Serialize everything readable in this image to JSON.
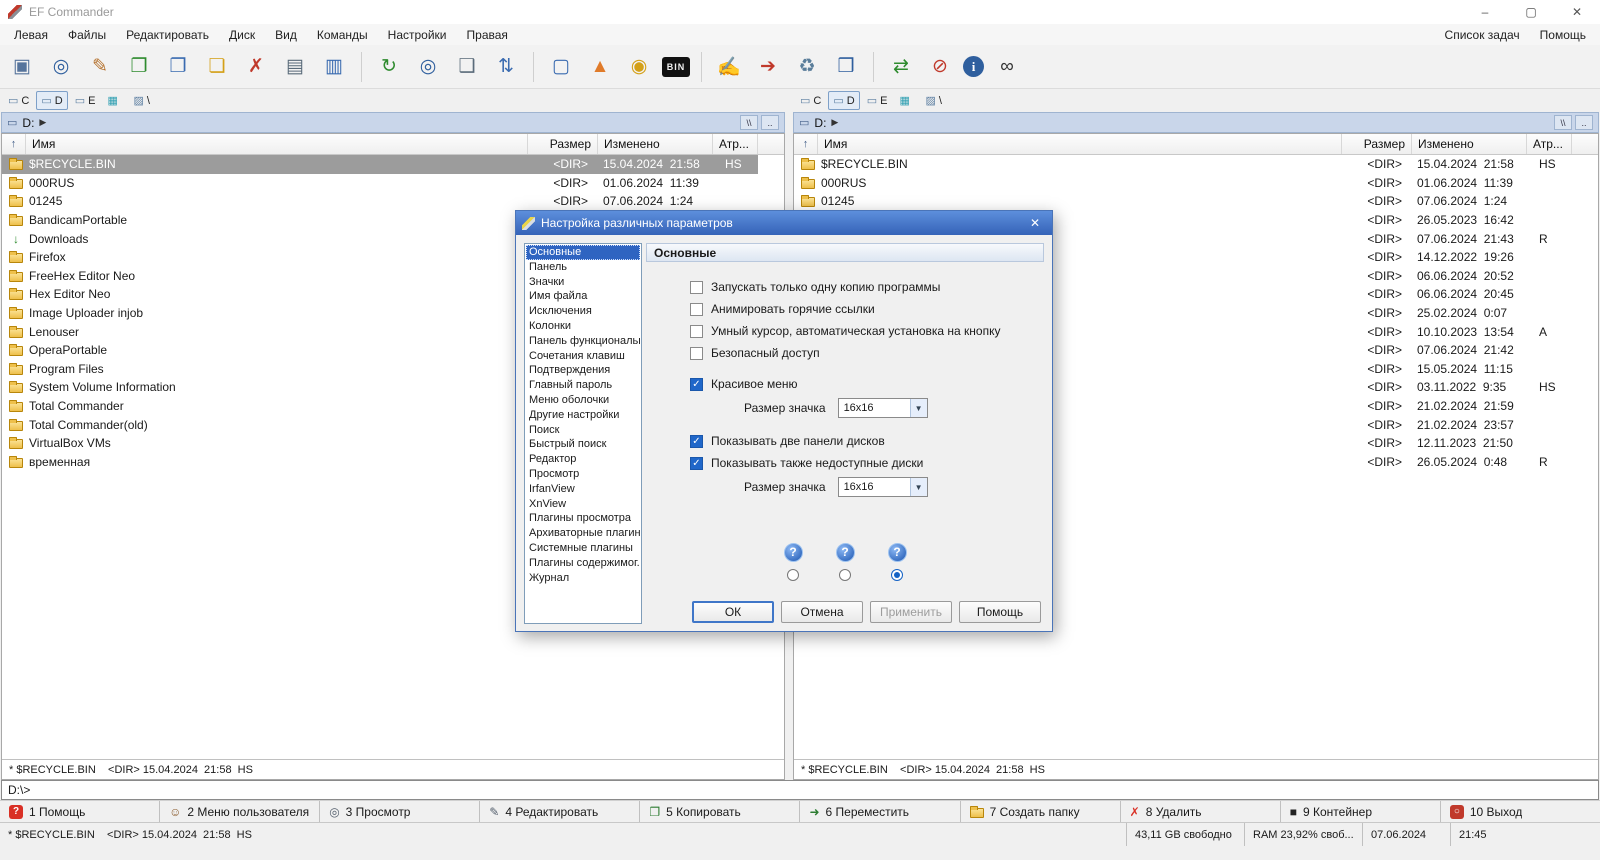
{
  "window": {
    "title": "EF Commander"
  },
  "window_controls": {
    "minimize": "–",
    "maximize": "▢",
    "close": "✕"
  },
  "menubar": {
    "items": [
      "Левая",
      "Файлы",
      "Редактировать",
      "Диск",
      "Вид",
      "Команды",
      "Настройки",
      "Правая"
    ],
    "right_items": [
      "Список задач",
      "Помощь"
    ]
  },
  "toolbar": {
    "groups": [
      [
        {
          "name": "console-window-icon",
          "glyph": "▣",
          "color": "#56749c"
        },
        {
          "name": "search-icon",
          "glyph": "◎",
          "color": "#2f5f9e"
        },
        {
          "name": "edit-file-icon",
          "glyph": "✎",
          "color": "#b5722e"
        },
        {
          "name": "copy-files-icon",
          "glyph": "❐",
          "color": "#2e8b2e"
        },
        {
          "name": "compare-files-icon",
          "glyph": "❐",
          "color": "#3a6bb0"
        },
        {
          "name": "move-folder-icon",
          "glyph": "❏",
          "color": "#d4a017"
        },
        {
          "name": "delete-file-icon",
          "glyph": "✗",
          "color": "#c0392b"
        },
        {
          "name": "print-icon",
          "glyph": "▤",
          "color": "#5a6b7a"
        },
        {
          "name": "properties-icon",
          "glyph": "▥",
          "color": "#3a6bb0"
        }
      ],
      [
        {
          "name": "refresh-icon",
          "glyph": "↻",
          "color": "#2e8b2e"
        },
        {
          "name": "find-files-icon",
          "glyph": "◎",
          "color": "#2f5f9e"
        },
        {
          "name": "split-view-icon",
          "glyph": "❑",
          "color": "#5a6b7a"
        },
        {
          "name": "sync-dirs-icon",
          "glyph": "⇅",
          "color": "#3a6bb0"
        }
      ],
      [
        {
          "name": "quick-view-icon",
          "glyph": "▢",
          "color": "#3a6bb0"
        },
        {
          "name": "cone-icon",
          "glyph": "▲",
          "color": "#e07b2a"
        },
        {
          "name": "search-new-icon",
          "glyph": "◉",
          "color": "#d4a017"
        },
        {
          "name": "hex-view-icon",
          "glyph": "BIN",
          "color": "#f0f0f0",
          "bg": "#111111"
        }
      ],
      [
        {
          "name": "checklist-edit-icon",
          "glyph": "✍",
          "color": "#3a6bb0"
        },
        {
          "name": "screen-export-icon",
          "glyph": "➔",
          "color": "#c0392b"
        },
        {
          "name": "recycle-bin-icon",
          "glyph": "♻",
          "color": "#5a7d9a"
        },
        {
          "name": "remote-screen-icon",
          "glyph": "❒",
          "color": "#2f5f9e"
        }
      ],
      [
        {
          "name": "swap-panels-icon",
          "glyph": "⇄",
          "color": "#2e8b2e"
        },
        {
          "name": "disconnect-icon",
          "glyph": "⊘",
          "color": "#c0392b"
        },
        {
          "name": "info-icon",
          "glyph": "i",
          "color": "#ffffff",
          "bg": "#2f5f9e",
          "round": true
        },
        {
          "name": "find-duplicates-icon",
          "glyph": "∞",
          "color": "#333333"
        }
      ]
    ]
  },
  "panels": {
    "left": {
      "drives": [
        {
          "glyph": "▭",
          "label": "C"
        },
        {
          "glyph": "▭",
          "label": "D",
          "pressed": true
        },
        {
          "glyph": "▭",
          "label": "E"
        },
        {
          "glyph": "▦",
          "label": "",
          "color": "#2a9db0"
        },
        {
          "glyph": "▨",
          "label": "\\",
          "color": "#5a7da0"
        }
      ],
      "path": "D:",
      "path_glyph": "▭",
      "path_arrow": "▶",
      "path_buttons": [
        "\\\\",
        ".."
      ],
      "columns": [
        "Имя",
        "Размер",
        "Изменено",
        "Атр..."
      ],
      "rows": [
        {
          "icon": "folder",
          "name": "$RECYCLE.BIN",
          "size": "<DIR>",
          "date": "15.04.2024  21:58",
          "attr": "HS",
          "selected": true
        },
        {
          "icon": "folder",
          "name": "000RUS",
          "size": "<DIR>",
          "date": "01.06.2024  11:39",
          "attr": ""
        },
        {
          "icon": "folder",
          "name": "01245",
          "size": "<DIR>",
          "date": "07.06.2024  1:24",
          "attr": ""
        },
        {
          "icon": "folder",
          "name": "BandicamPortable",
          "size": "",
          "date": "",
          "attr": ""
        },
        {
          "icon": "downloads",
          "name": "Downloads",
          "size": "",
          "date": "",
          "attr": ""
        },
        {
          "icon": "folder",
          "name": "Firefox",
          "size": "",
          "date": "",
          "attr": ""
        },
        {
          "icon": "folder",
          "name": "FreeHex Editor Neo",
          "size": "",
          "date": "",
          "attr": ""
        },
        {
          "icon": "folder",
          "name": "Hex Editor Neo",
          "size": "",
          "date": "",
          "attr": ""
        },
        {
          "icon": "folder",
          "name": "Image Uploader injob",
          "size": "",
          "date": "",
          "attr": ""
        },
        {
          "icon": "folder",
          "name": "Lenouser",
          "size": "",
          "date": "",
          "attr": ""
        },
        {
          "icon": "folder",
          "name": "OperaPortable",
          "size": "",
          "date": "",
          "attr": ""
        },
        {
          "icon": "folder",
          "name": "Program Files",
          "size": "",
          "date": "",
          "attr": ""
        },
        {
          "icon": "folder",
          "name": "System Volume Information",
          "size": "",
          "date": "",
          "attr": ""
        },
        {
          "icon": "folder",
          "name": "Total Commander",
          "size": "",
          "date": "",
          "attr": ""
        },
        {
          "icon": "folder",
          "name": "Total Commander(old)",
          "size": "",
          "date": "",
          "attr": ""
        },
        {
          "icon": "folder",
          "name": "VirtualBox VMs",
          "size": "",
          "date": "",
          "attr": ""
        },
        {
          "icon": "folder",
          "name": "временная",
          "size": "",
          "date": "",
          "attr": ""
        }
      ],
      "status": "* $RECYCLE.BIN    <DIR> 15.04.2024  21:58  HS"
    },
    "right": {
      "drives": [
        {
          "glyph": "▭",
          "label": "C"
        },
        {
          "glyph": "▭",
          "label": "D",
          "pressed": true
        },
        {
          "glyph": "▭",
          "label": "E"
        },
        {
          "glyph": "▦",
          "label": "",
          "color": "#2a9db0"
        },
        {
          "glyph": "▨",
          "label": "\\",
          "color": "#5a7da0"
        }
      ],
      "path": "D:",
      "path_glyph": "▭",
      "path_arrow": "▶",
      "path_buttons": [
        "\\\\",
        ".."
      ],
      "columns": [
        "Имя",
        "Размер",
        "Изменено",
        "Атр..."
      ],
      "rows": [
        {
          "icon": "folder",
          "name": "$RECYCLE.BIN",
          "size": "<DIR>",
          "date": "15.04.2024  21:58",
          "attr": "HS"
        },
        {
          "icon": "folder",
          "name": "000RUS",
          "size": "<DIR>",
          "date": "01.06.2024  11:39",
          "attr": ""
        },
        {
          "icon": "folder",
          "name": "01245",
          "size": "<DIR>",
          "date": "07.06.2024  1:24",
          "attr": ""
        },
        {
          "icon": "none",
          "name": "",
          "size": "<DIR>",
          "date": "26.05.2023  16:42",
          "attr": ""
        },
        {
          "icon": "none",
          "name": "",
          "size": "<DIR>",
          "date": "07.06.2024  21:43",
          "attr": "R"
        },
        {
          "icon": "none",
          "name": "",
          "size": "<DIR>",
          "date": "14.12.2022  19:26",
          "attr": ""
        },
        {
          "icon": "none",
          "name": "",
          "size": "<DIR>",
          "date": "06.06.2024  20:52",
          "attr": ""
        },
        {
          "icon": "none",
          "name": "",
          "size": "<DIR>",
          "date": "06.06.2024  20:45",
          "attr": ""
        },
        {
          "icon": "none",
          "name": "",
          "size": "<DIR>",
          "date": "25.02.2024  0:07",
          "attr": ""
        },
        {
          "icon": "none",
          "name": "",
          "size": "<DIR>",
          "date": "10.10.2023  13:54",
          "attr": "A"
        },
        {
          "icon": "none",
          "name": "",
          "size": "<DIR>",
          "date": "07.06.2024  21:42",
          "attr": ""
        },
        {
          "icon": "none",
          "name": "",
          "size": "<DIR>",
          "date": "15.05.2024  11:15",
          "attr": ""
        },
        {
          "icon": "none",
          "name": "",
          "size": "<DIR>",
          "date": "03.11.2022  9:35",
          "attr": "HS"
        },
        {
          "icon": "none",
          "name": "",
          "size": "<DIR>",
          "date": "21.02.2024  21:59",
          "attr": ""
        },
        {
          "icon": "none",
          "name": "",
          "size": "<DIR>",
          "date": "21.02.2024  23:57",
          "attr": ""
        },
        {
          "icon": "none",
          "name": "",
          "size": "<DIR>",
          "date": "12.11.2023  21:50",
          "attr": ""
        },
        {
          "icon": "none",
          "name": "",
          "size": "<DIR>",
          "date": "26.05.2024  0:48",
          "attr": "R"
        }
      ],
      "status": "* $RECYCLE.BIN    <DIR> 15.04.2024  21:58  HS"
    }
  },
  "dialog": {
    "title": "Настройка различных параметров",
    "close_glyph": "✕",
    "categories": [
      "Основные",
      "Панель",
      "Значки",
      "Имя файла",
      "Исключения",
      "Колонки",
      "Панель функциональны...",
      "Сочетания клавиш",
      "Подтверждения",
      "Главный пароль",
      "Меню оболочки",
      "Другие настройки",
      "Поиск",
      "Быстрый поиск",
      "Редактор",
      "Просмотр",
      "IrfanView",
      "XnView",
      "Плагины просмотра",
      "Архиваторные плагин...",
      "Системные плагины",
      "Плагины содержимог...",
      "Журнал"
    ],
    "selected_category": "Основные",
    "section_title": "Основные",
    "options": [
      {
        "type": "checkbox",
        "label": "Запускать только одну копию программы",
        "checked": false
      },
      {
        "type": "checkbox",
        "label": "Анимировать горячие ссылки",
        "checked": false
      },
      {
        "type": "checkbox",
        "label": "Умный курсор, автоматическая установка на кнопку",
        "checked": false
      },
      {
        "type": "checkbox",
        "label": "Безопасный доступ",
        "checked": false
      },
      {
        "type": "spacer"
      },
      {
        "type": "checkbox",
        "label": "Красивое меню",
        "checked": true
      },
      {
        "type": "combo",
        "label": "Размер значка",
        "value": "16x16"
      },
      {
        "type": "spacer"
      },
      {
        "type": "checkbox",
        "label": "Показывать две панели дисков",
        "checked": true
      },
      {
        "type": "checkbox",
        "label": "Показывать также недоступные диски",
        "checked": true
      },
      {
        "type": "combo",
        "label": "Размер значка",
        "value": "16x16"
      }
    ],
    "icon_style_choices": [
      {
        "glyph": "?",
        "selected": false
      },
      {
        "glyph": "?",
        "selected": false
      },
      {
        "glyph": "?",
        "selected": true
      }
    ],
    "buttons": [
      {
        "label": "ОК",
        "default": true
      },
      {
        "label": "Отмена"
      },
      {
        "label": "Применить",
        "disabled": true
      },
      {
        "label": "Помощь"
      }
    ]
  },
  "command_line": {
    "prompt": "D:\\>"
  },
  "function_bar": [
    {
      "key": "1",
      "label": "Помощь",
      "icon": {
        "name": "help-icon",
        "glyph": "?",
        "color": "#ffffff",
        "bg": "#d93025"
      }
    },
    {
      "key": "2",
      "label": "Меню пользователя",
      "icon": {
        "name": "user-menu-icon",
        "glyph": "☺",
        "color": "#8a5a2b"
      }
    },
    {
      "key": "3",
      "label": "Просмотр",
      "icon": {
        "name": "view-icon",
        "glyph": "◎",
        "color": "#55606e"
      }
    },
    {
      "key": "4",
      "label": "Редактировать",
      "icon": {
        "name": "edit-icon",
        "glyph": "✎",
        "color": "#55606e"
      }
    },
    {
      "key": "5",
      "label": "Копировать",
      "icon": {
        "name": "copy-icon",
        "glyph": "❐",
        "color": "#2e7d32"
      }
    },
    {
      "key": "6",
      "label": "Переместить",
      "icon": {
        "name": "move-icon",
        "glyph": "➜",
        "color": "#2e7d32"
      }
    },
    {
      "key": "7",
      "label": "Создать папку",
      "icon": {
        "name": "new-folder-icon",
        "glyph": "folder"
      }
    },
    {
      "key": "8",
      "label": "Удалить",
      "icon": {
        "name": "delete-icon",
        "glyph": "✗",
        "color": "#d93025"
      }
    },
    {
      "key": "9",
      "label": "Контейнер",
      "icon": {
        "name": "container-icon",
        "glyph": "■",
        "color": "#222222"
      }
    },
    {
      "key": "10",
      "label": "Выход",
      "icon": {
        "name": "exit-icon",
        "glyph": "○",
        "color": "#ffffff",
        "bg": "#c0392b"
      }
    }
  ],
  "status_bar": {
    "selection": "* $RECYCLE.BIN    <DIR> 15.04.2024  21:58  HS",
    "segments": [
      "43,11 GB свободно",
      "RAM 23,92% своб...",
      "07.06.2024",
      "21:45"
    ]
  }
}
